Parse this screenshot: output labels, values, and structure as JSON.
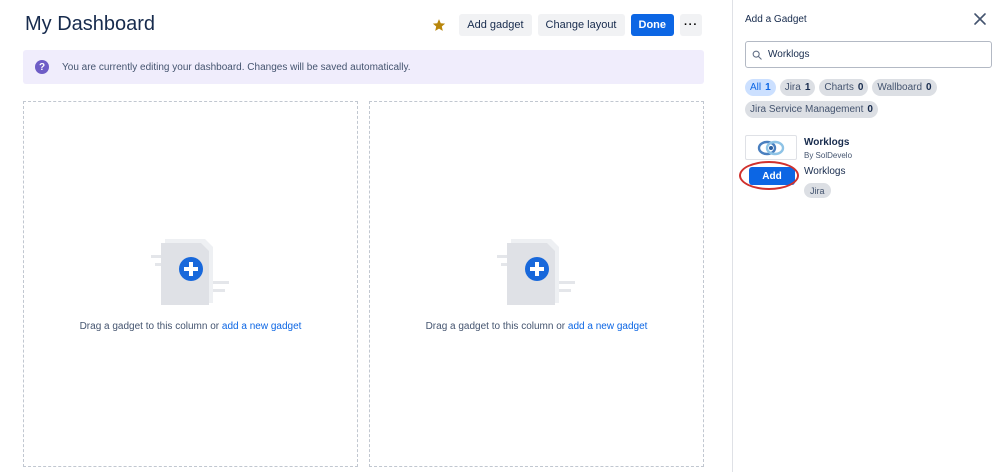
{
  "page": {
    "title": "My Dashboard"
  },
  "toolbar": {
    "star_icon": "star-icon",
    "star_color": "#b8860b",
    "add_gadget_label": "Add gadget",
    "change_layout_label": "Change layout",
    "done_label": "Done",
    "more_label": "···"
  },
  "banner": {
    "icon": "question-icon",
    "icon_glyph": "?",
    "text": "You are currently editing your dashboard. Changes will be saved automatically."
  },
  "columns": [
    {
      "text": "Drag a gadget to this column or ",
      "link": "add a new gadget"
    },
    {
      "text": "Drag a gadget to this column or ",
      "link": "add a new gadget"
    }
  ],
  "panel": {
    "title": "Add a Gadget",
    "search": {
      "value": "Worklogs",
      "placeholder": "Search"
    },
    "filters": [
      {
        "label": "All",
        "count": "1",
        "selected": true
      },
      {
        "label": "Jira",
        "count": "1",
        "selected": false
      },
      {
        "label": "Charts",
        "count": "0",
        "selected": false
      },
      {
        "label": "Wallboard",
        "count": "0",
        "selected": false
      },
      {
        "label": "Jira Service Management",
        "count": "0",
        "selected": false
      }
    ],
    "gadget": {
      "name": "Worklogs",
      "vendor": "By SolDevelo",
      "description": "Worklogs",
      "tag": "Jira",
      "add_label": "Add"
    }
  },
  "colors": {
    "primary": "#0c66e4",
    "banner_bg": "#f0edfc",
    "highlight": "#d0312d"
  }
}
